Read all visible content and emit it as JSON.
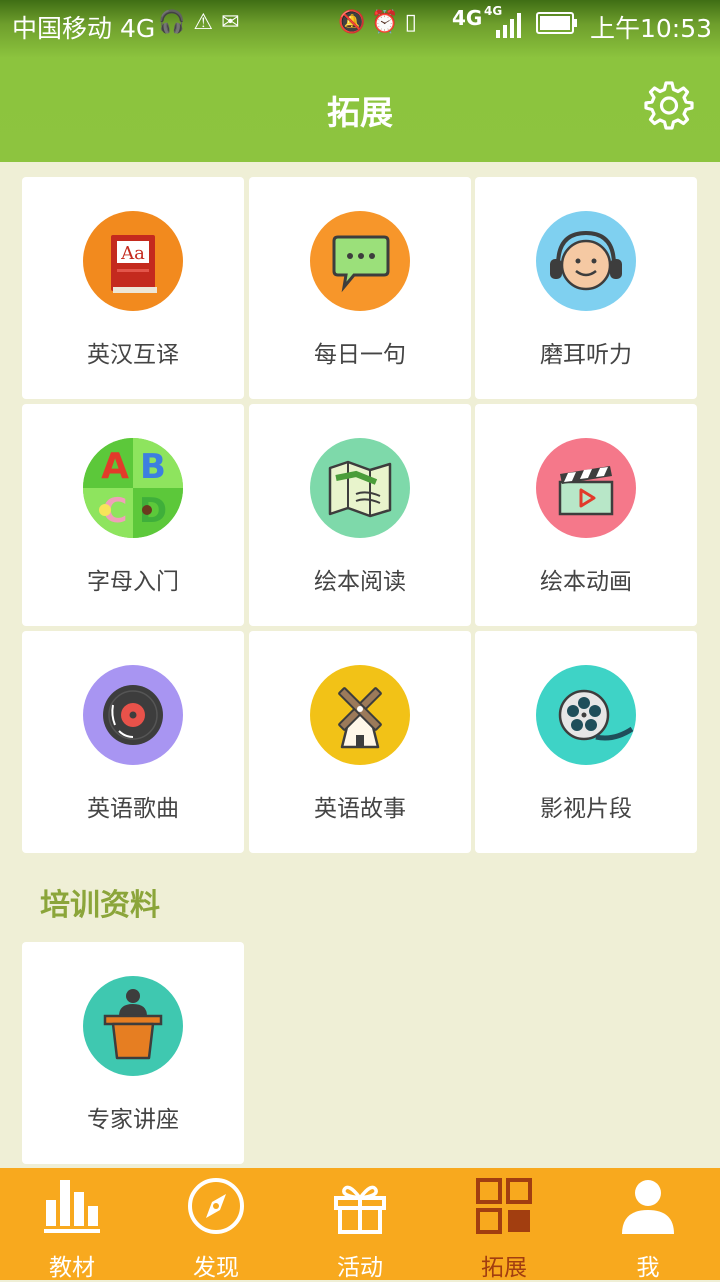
{
  "status_bar": {
    "carrier": "中国移动 4G",
    "network_label": "4G",
    "network_small": "4G",
    "time": "上午10:53"
  },
  "header": {
    "title": "拓展"
  },
  "grid": {
    "items": [
      {
        "label": "英汉互译",
        "icon": "dictionary-book-icon",
        "color": "#F28A1E"
      },
      {
        "label": "每日一句",
        "icon": "chat-bubble-icon",
        "color": "#F7962A"
      },
      {
        "label": "磨耳听力",
        "icon": "headphones-face-icon",
        "color": "#7FD0F0"
      },
      {
        "label": "字母入门",
        "icon": "alphabet-blocks-icon",
        "color": "#78D64B"
      },
      {
        "label": "绘本阅读",
        "icon": "open-map-book-icon",
        "color": "#7ED9AA"
      },
      {
        "label": "绘本动画",
        "icon": "clapperboard-icon",
        "color": "#F5788A"
      },
      {
        "label": "英语歌曲",
        "icon": "vinyl-record-icon",
        "color": "#A895F2"
      },
      {
        "label": "英语故事",
        "icon": "windmill-icon",
        "color": "#F2C217"
      },
      {
        "label": "影视片段",
        "icon": "film-reel-icon",
        "color": "#3ED3C6"
      }
    ]
  },
  "training": {
    "section_title": "培训资料",
    "items": [
      {
        "label": "专家讲座",
        "icon": "lecturer-podium-icon",
        "color": "#3FC8B0"
      }
    ]
  },
  "bottom_nav": {
    "items": [
      {
        "label": "教材",
        "icon": "bar-chart-icon",
        "active": false
      },
      {
        "label": "发现",
        "icon": "compass-icon",
        "active": false
      },
      {
        "label": "活动",
        "icon": "gift-icon",
        "active": false
      },
      {
        "label": "拓展",
        "icon": "grid-icon",
        "active": true
      },
      {
        "label": "我",
        "icon": "user-icon",
        "active": false
      }
    ],
    "active_color": "#A23E10",
    "background": "#F8A91E"
  },
  "colors": {
    "header_green": "#8DC43F",
    "page_background": "#EFEFD6",
    "section_title": "#8BA53A"
  }
}
